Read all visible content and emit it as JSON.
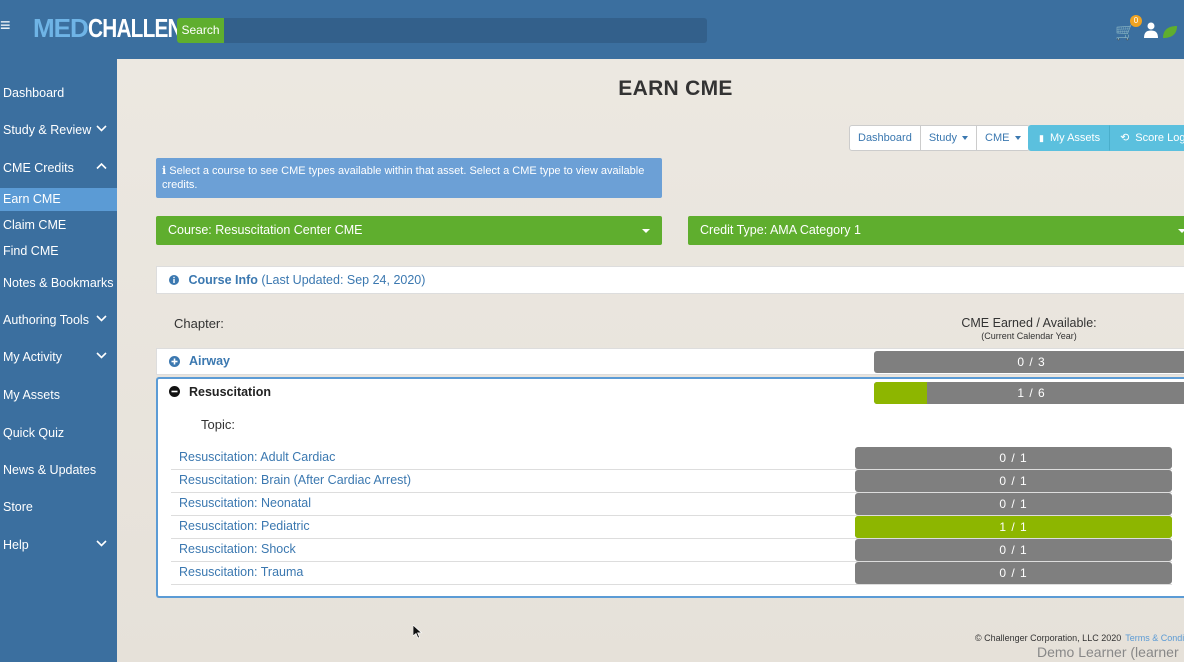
{
  "header": {
    "logo_med": "MED",
    "logo_challenger": "CHALLENGER",
    "search_label": "Search",
    "search_placeholder": "",
    "cart_count": "0"
  },
  "sidebar": {
    "items": [
      {
        "label": "Dashboard"
      },
      {
        "label": "Study & Review"
      },
      {
        "label": "CME Credits"
      },
      {
        "label": "Earn CME"
      },
      {
        "label": "Claim CME"
      },
      {
        "label": "Find CME"
      },
      {
        "label": "Notes & Bookmarks"
      },
      {
        "label": "Authoring Tools"
      },
      {
        "label": "My Activity"
      },
      {
        "label": "My Assets"
      },
      {
        "label": "Quick Quiz"
      },
      {
        "label": "News & Updates"
      },
      {
        "label": "Store"
      },
      {
        "label": "Help"
      }
    ]
  },
  "page": {
    "title": "EARN CME"
  },
  "toolbar": {
    "dashboard": "Dashboard",
    "study": "Study",
    "cme": "CME",
    "my_assets": "My Assets",
    "score_log": "Score Log"
  },
  "alert": {
    "text": "Select a course to see CME types available within that asset. Select a CME type to view available credits."
  },
  "filters": {
    "course": "Course: Resuscitation Center CME",
    "credit_type": "Credit Type: AMA Category 1"
  },
  "course_info": {
    "label": "Course Info",
    "updated": "(Last Updated: Sep 24, 2020)"
  },
  "table": {
    "chapter_header": "Chapter:",
    "cme_header": "CME Earned / Available:",
    "cme_subheader": "(Current Calendar Year)",
    "topic_header": "Topic:",
    "chapters": [
      {
        "title": "Airway",
        "earned": 0,
        "available": 3,
        "progress_text": "0 / 3"
      },
      {
        "title": "Resuscitation",
        "earned": 1,
        "available": 6,
        "progress_text": "1 / 6"
      }
    ],
    "topics": [
      {
        "title": "Resuscitation: Adult Cardiac",
        "progress_text": "0 / 1",
        "fraction": 0
      },
      {
        "title": "Resuscitation: Brain (After Cardiac Arrest)",
        "progress_text": "0 / 1",
        "fraction": 0
      },
      {
        "title": "Resuscitation: Neonatal",
        "progress_text": "0 / 1",
        "fraction": 0
      },
      {
        "title": "Resuscitation: Pediatric",
        "progress_text": "1 / 1",
        "fraction": 1
      },
      {
        "title": "Resuscitation: Shock",
        "progress_text": "0 / 1",
        "fraction": 0
      },
      {
        "title": "Resuscitation: Trauma",
        "progress_text": "0 / 1",
        "fraction": 0
      }
    ]
  },
  "footer": {
    "copyright": "© Challenger Corporation, LLC 2020",
    "terms": "Terms & Conditions",
    "user": "Demo Learner (learner"
  },
  "colors": {
    "header_bg": "#3b6f9f",
    "accent_green": "#5fae2e",
    "progress_green": "#8db600",
    "link_blue": "#3b78b0"
  }
}
